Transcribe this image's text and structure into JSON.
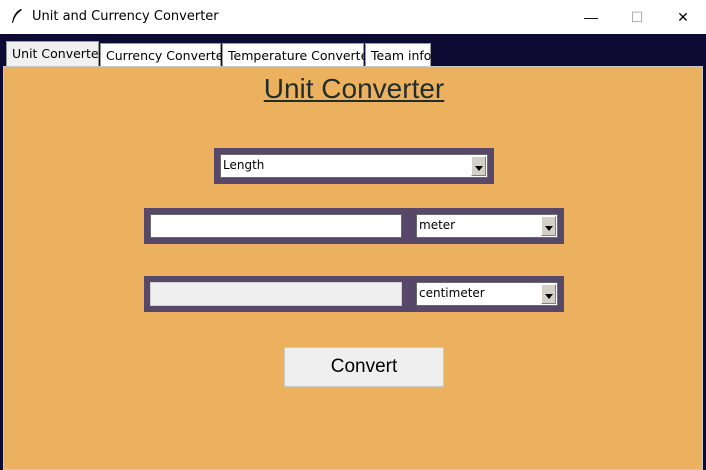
{
  "window": {
    "title": "Unit and Currency Converter",
    "icon": "feather-icon",
    "controls": {
      "minimize": "—",
      "maximize": "☐",
      "close": "✕"
    }
  },
  "tabs": [
    {
      "label": "Unit Converter",
      "active": true
    },
    {
      "label": "Currency Converter",
      "active": false
    },
    {
      "label": "Temperature Converter",
      "active": false
    },
    {
      "label": "Team info",
      "active": false
    }
  ],
  "main": {
    "heading": "Unit Converter",
    "category_select": {
      "value": "Length"
    },
    "from": {
      "value": "",
      "unit": "meter"
    },
    "to": {
      "value": "",
      "unit": "centimeter"
    },
    "convert_label": "Convert"
  },
  "colors": {
    "panel_bg": "#ecb15f",
    "frame": "#574768",
    "tabstrip_bg": "#0d0a33"
  }
}
